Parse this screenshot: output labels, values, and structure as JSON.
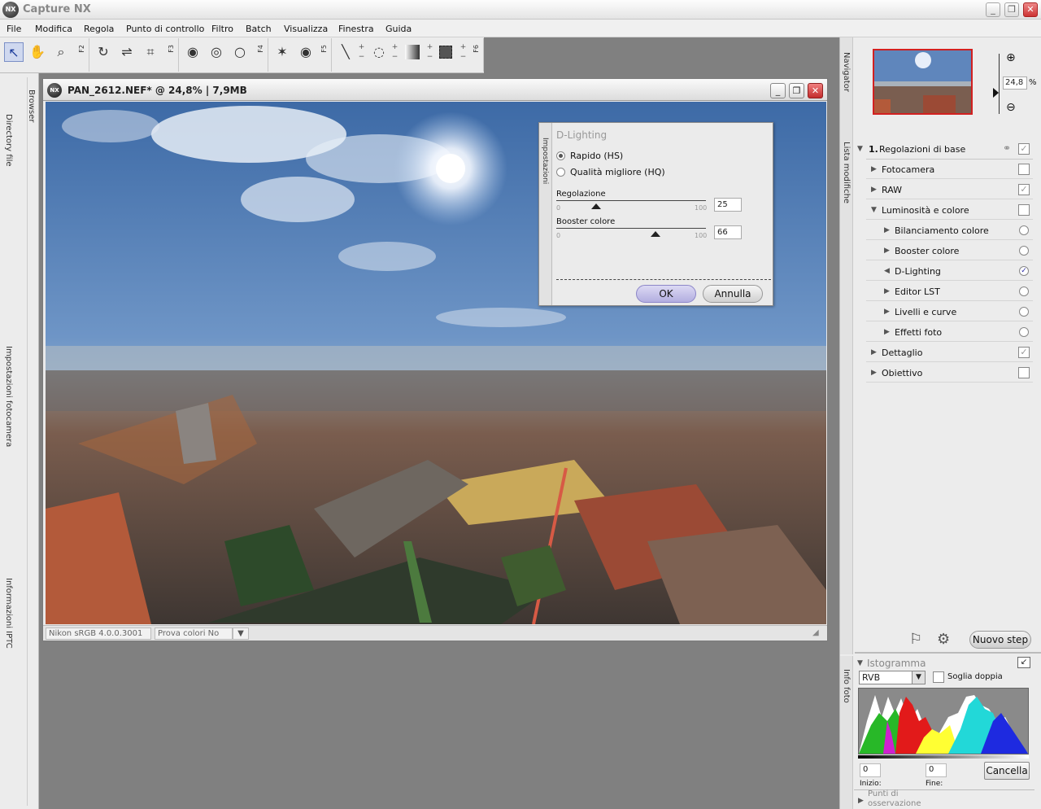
{
  "app": {
    "title": "Capture NX",
    "logo_text": "NX"
  },
  "window_controls": {
    "minimize": "_",
    "restore": "❐",
    "close": "✕"
  },
  "menu": [
    "File",
    "Modifica",
    "Regola",
    "Punto di controllo",
    "Filtro",
    "Batch",
    "Visualizza",
    "Finestra",
    "Guida"
  ],
  "toolbar": {
    "fkeys": [
      "F2",
      "F3",
      "F4",
      "F5",
      "F6"
    ],
    "tools": [
      "select-arrow",
      "hand",
      "zoom",
      "rotate",
      "straighten",
      "crop",
      "black-point",
      "neutral-point",
      "white-point",
      "red-eye",
      "eye",
      "brush",
      "lasso",
      "gradient",
      "marquee"
    ]
  },
  "left_dock": {
    "tabs": [
      "Browser",
      "Directory file",
      "Impostazioni fotocamera",
      "Informazioni IPTC"
    ]
  },
  "document": {
    "title": "PAN_2612.NEF* @ 24,8% | 7,9MB",
    "profile": "Nikon sRGB 4.0.0.3001",
    "softproof": "Prova colori No"
  },
  "dlighting": {
    "side_tab": "Impostazioni",
    "title": "D-Lighting",
    "option_hs": "Rapido (HS)",
    "option_hq": "Qualità migliore (HQ)",
    "selected": "hs",
    "regolazione_label": "Regolazione",
    "regolazione_value": "25",
    "booster_label": "Booster colore",
    "booster_value": "66",
    "min": "0",
    "max": "100",
    "ok": "OK",
    "cancel": "Annulla"
  },
  "navigator": {
    "tab": "Navigator",
    "zoom_value": "24,8",
    "zoom_unit": "%"
  },
  "edit_list": {
    "tab": "Lista modifiche",
    "step_number": "1.",
    "step_title": "Regolazioni di base",
    "rows": [
      {
        "label": "Fotocamera",
        "level": 1,
        "expanded": false,
        "checked": false
      },
      {
        "label": "RAW",
        "level": 1,
        "expanded": false,
        "checked": true
      },
      {
        "label": "Luminosità e colore",
        "level": 1,
        "expanded": true,
        "checked": false
      },
      {
        "label": "Bilanciamento colore",
        "level": 2,
        "expanded": false,
        "checked": false
      },
      {
        "label": "Booster colore",
        "level": 2,
        "expanded": false,
        "checked": false
      },
      {
        "label": "D-Lighting",
        "level": 2,
        "expanded": false,
        "checked": true,
        "active": true
      },
      {
        "label": "Editor LST",
        "level": 2,
        "expanded": false,
        "checked": false
      },
      {
        "label": "Livelli e curve",
        "level": 2,
        "expanded": false,
        "checked": false
      },
      {
        "label": "Effetti foto",
        "level": 2,
        "expanded": false,
        "checked": false
      },
      {
        "label": "Dettaglio",
        "level": 1,
        "expanded": false,
        "checked": true
      },
      {
        "label": "Obiettivo",
        "level": 1,
        "expanded": false,
        "checked": false
      }
    ],
    "new_step": "Nuovo step"
  },
  "histogram": {
    "tab": "Info foto",
    "title": "Istogramma",
    "channel": "RVB",
    "dual_threshold": "Soglia doppia",
    "start_value": "0",
    "end_value": "0",
    "start_label": "Inizio:",
    "end_label": "Fine:",
    "cancel": "Cancella",
    "footer": "Punti di osservazione"
  },
  "colors": {
    "accent": "#1a3a9a",
    "close_red": "#c32b2b",
    "ok_button": "#c8c4ea",
    "nav_frame": "#d22020"
  }
}
